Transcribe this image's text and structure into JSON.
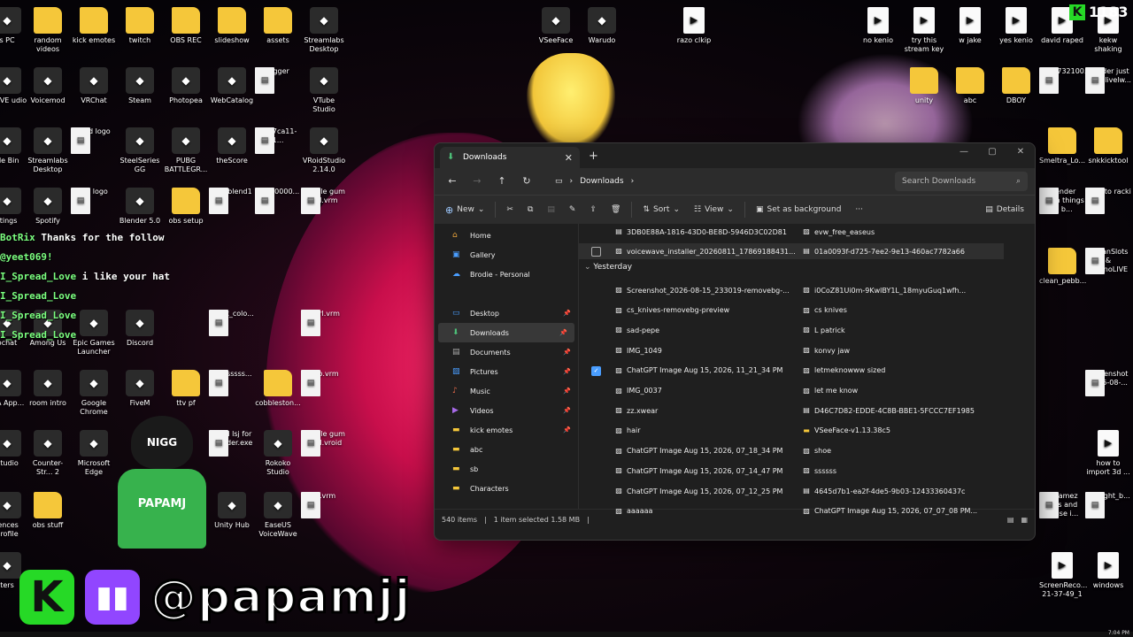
{
  "stream_overlay": {
    "chat": [
      {
        "user": "BotRix",
        "msg": "Thanks for the follow"
      },
      {
        "user": "@yeet069!",
        "msg": ""
      },
      {
        "user": "I_Spread_Love",
        "msg": "i like your hat"
      },
      {
        "user": "I_Spread_Love",
        "msg": ""
      },
      {
        "user": "I_Spread_Love",
        "msg": ""
      },
      {
        "user": "I_Spread_Love",
        "msg": ""
      }
    ],
    "handle": "@papamjj",
    "kick_letter": "K",
    "viewer_count": "1183",
    "avatar_hat_text": "NIGG",
    "avatar_shirt_text": "PAPAMJ"
  },
  "desktop": {
    "icons": [
      {
        "label": "s PC",
        "type": "app"
      },
      {
        "label": "random videos",
        "type": "folder"
      },
      {
        "label": "kick emotes",
        "type": "folder"
      },
      {
        "label": "twitch",
        "type": "folder"
      },
      {
        "label": "OBS REC",
        "type": "folder"
      },
      {
        "label": "slideshow",
        "type": "folder"
      },
      {
        "label": "assets",
        "type": "folder"
      },
      {
        "label": "Streamlabs Desktop",
        "type": "app"
      },
      {
        "label": "VSeeFace",
        "type": "app"
      },
      {
        "label": "Warudo",
        "type": "app"
      },
      {
        "label": "razo clkip",
        "type": "video"
      },
      {
        "label": "no kenio",
        "type": "video"
      },
      {
        "label": "try this stream key",
        "type": "video"
      },
      {
        "label": "w jake",
        "type": "video"
      },
      {
        "label": "yes kenio",
        "type": "video"
      },
      {
        "label": "david raped",
        "type": "video"
      },
      {
        "label": "kekw shaking",
        "type": "video"
      },
      {
        "label": "k LIVE udio",
        "type": "app"
      },
      {
        "label": "Voicemod",
        "type": "app"
      },
      {
        "label": "VRChat",
        "type": "app"
      },
      {
        "label": "Steam",
        "type": "app"
      },
      {
        "label": "Photopea",
        "type": "app"
      },
      {
        "label": "WebCatalog",
        "type": "app"
      },
      {
        "label": "nigger",
        "type": "file"
      },
      {
        "label": "VTube Studio",
        "type": "app"
      },
      {
        "label": "unity",
        "type": "folder"
      },
      {
        "label": "abc",
        "type": "folder"
      },
      {
        "label": "DBOY",
        "type": "folder"
      },
      {
        "label": "2843732100...",
        "type": "file"
      },
      {
        "label": "Trodder just went livelw...",
        "type": "file"
      },
      {
        "label": "cle Bin",
        "type": "app"
      },
      {
        "label": "Streamlabs Desktop",
        "type": "app"
      },
      {
        "label": "mod logo",
        "type": "file"
      },
      {
        "label": "SteelSeries GG",
        "type": "app"
      },
      {
        "label": "PUBG BATTLEGR...",
        "type": "app"
      },
      {
        "label": "theScore",
        "type": "app"
      },
      {
        "label": "2287ca11-1...",
        "type": "file"
      },
      {
        "label": "VRoidStudio 2.14.0",
        "type": "app"
      },
      {
        "label": "Smeltra_Lo...",
        "type": "folder"
      },
      {
        "label": "snkkicktool",
        "type": "folder"
      },
      {
        "label": "ttings",
        "type": "app"
      },
      {
        "label": "Spotify",
        "type": "app"
      },
      {
        "label": "vip logo",
        "type": "file"
      },
      {
        "label": "Blender 5.0",
        "type": "app"
      },
      {
        "label": "obs setup",
        "type": "folder"
      },
      {
        "label": "test.blend1",
        "type": "file"
      },
      {
        "label": "00000000...",
        "type": "file"
      },
      {
        "label": "bubble gum girl.vrm",
        "type": "file"
      },
      {
        "label": "blender atach things to b...",
        "type": "file"
      },
      {
        "label": "send to racki",
        "type": "file"
      },
      {
        "label": "clean_pebb...",
        "type": "folder"
      },
      {
        "label": "JordanSlots & CasinoLIVE",
        "type": "file"
      },
      {
        "label": "ochat",
        "type": "app"
      },
      {
        "label": "Among Us",
        "type": "app"
      },
      {
        "label": "Epic Games Launcher",
        "type": "app"
      },
      {
        "label": "Discord",
        "type": "app"
      },
      {
        "label": "Black_colo...",
        "type": "file"
      },
      {
        "label": "egirl.vrm",
        "type": "file"
      },
      {
        "label": "TIA App...",
        "type": "app"
      },
      {
        "label": "room intro",
        "type": "app"
      },
      {
        "label": "Google Chrome",
        "type": "app"
      },
      {
        "label": "FiveM",
        "type": "app"
      },
      {
        "label": "ttv pf",
        "type": "folder"
      },
      {
        "label": "sssssssss...",
        "type": "file"
      },
      {
        "label": "cobbleston...",
        "type": "folder"
      },
      {
        "label": "bob.vrm",
        "type": "file"
      },
      {
        "label": "Screenshot 2026-08-...",
        "type": "file"
      },
      {
        "label": "Studio",
        "type": "app"
      },
      {
        "label": "Counter-Str... 2",
        "type": "app"
      },
      {
        "label": "Microsoft Edge",
        "type": "app"
      },
      {
        "label": "good lsj for blender.exe",
        "type": "file"
      },
      {
        "label": "Rokoko Studio",
        "type": "app"
      },
      {
        "label": "bubble gum egirl.vroid",
        "type": "file"
      },
      {
        "label": "how to import 3d ...",
        "type": "video"
      },
      {
        "label": "iences profile",
        "type": "app"
      },
      {
        "label": "obs stuff",
        "type": "folder"
      },
      {
        "label": "Unity Hub",
        "type": "app"
      },
      {
        "label": "EaseUS VoiceWave",
        "type": "app"
      },
      {
        "label": "bt.vrm",
        "type": "file"
      },
      {
        "label": "btgamez cars and house i...",
        "type": "file"
      },
      {
        "label": "be_right_b...",
        "type": "file"
      },
      {
        "label": "ters",
        "type": "app"
      },
      {
        "label": "ScreenReco... 21-37-49_1",
        "type": "video"
      },
      {
        "label": "windows",
        "type": "video"
      }
    ]
  },
  "explorer": {
    "tab_title": "Downloads",
    "breadcrumb": "Downloads",
    "search_placeholder": "Search Downloads",
    "toolbar": {
      "new": "New",
      "sort": "Sort",
      "view": "View",
      "set_background": "Set as background",
      "more": "···",
      "details": "Details"
    },
    "nav": [
      {
        "label": "Home",
        "icon": "home-icon"
      },
      {
        "label": "Gallery",
        "icon": "gallery-icon"
      },
      {
        "label": "Brodie - Personal",
        "icon": "cloud-icon"
      },
      {
        "label": "Desktop",
        "icon": "desktop-icon",
        "pinned": true
      },
      {
        "label": "Downloads",
        "icon": "download-icon",
        "pinned": true,
        "selected": true
      },
      {
        "label": "Documents",
        "icon": "documents-icon",
        "pinned": true
      },
      {
        "label": "Pictures",
        "icon": "pictures-icon",
        "pinned": true
      },
      {
        "label": "Music",
        "icon": "music-icon",
        "pinned": true
      },
      {
        "label": "Videos",
        "icon": "videos-icon",
        "pinned": true
      },
      {
        "label": "kick emotes",
        "icon": "folder-icon",
        "pinned": true
      },
      {
        "label": "abc",
        "icon": "folder-icon"
      },
      {
        "label": "sb",
        "icon": "folder-icon"
      },
      {
        "label": "Characters",
        "icon": "folder-icon"
      }
    ],
    "top_files": [
      {
        "name": "3DB0E88A-1816-43D0-BE8D-5946D3C02D81",
        "col": 1
      },
      {
        "name": "evw_free_easeus",
        "col": 2
      },
      {
        "name": "voicewave_installer_20260811_17869188431...",
        "col": 1,
        "hover": true
      },
      {
        "name": "01a0093f-d725-7ee2-9e13-460ac7782a66",
        "col": 2
      }
    ],
    "group_yesterday": "Yesterday",
    "files_col1": [
      "Screenshot_2026-08-15_233019-removebg-...",
      "cs_knives-removebg-preview",
      "sad-pepe",
      "IMG_1049",
      "ChatGPT Image Aug 15, 2026, 11_21_34 PM",
      "IMG_0037",
      "zz.xwear",
      "hair",
      "ChatGPT Image Aug 15, 2026, 07_18_34 PM",
      "ChatGPT Image Aug 15, 2026, 07_14_47 PM",
      "ChatGPT Image Aug 15, 2026, 07_12_25 PM",
      "aaaaaa"
    ],
    "files_col2": [
      "i0CoZ81Ui0m-9KwlBY1L_18myuGuq1wfh...",
      "cs knives",
      "L patrick",
      "konvy jaw",
      "letmeknowww sized",
      "let me know",
      "D46C7D82-EDDE-4C8B-BBE1-5FCCC7EF1985",
      "VSeeFace-v1.13.38c5",
      "shoe",
      "ssssss",
      "4645d7b1-ea2f-4de5-9b03-12433360437c",
      "ChatGPT Image Aug 15, 2026, 07_07_08 PM..."
    ],
    "selected_index_col1": 4,
    "status": {
      "items": "540 items",
      "selected": "1 item selected  1.58 MB"
    }
  },
  "taskbar": {
    "clock": "7:04 PM"
  }
}
